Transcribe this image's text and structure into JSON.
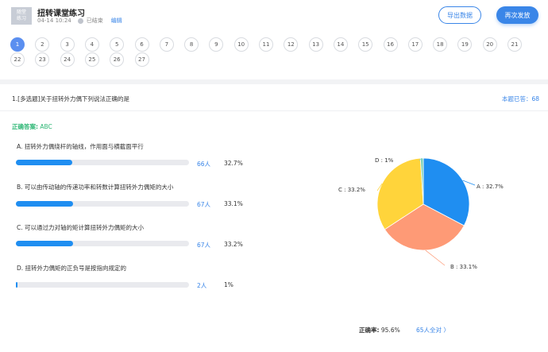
{
  "header": {
    "thumb_line1": "随堂",
    "thumb_line2": "练习",
    "title": "扭转课堂练习",
    "date": "04-14 10:24",
    "status": "已结束",
    "edit_label": "编辑",
    "export_label": "导出数据",
    "resend_label": "再次发放"
  },
  "question_numbers": [
    "1",
    "2",
    "3",
    "4",
    "5",
    "6",
    "7",
    "8",
    "9",
    "10",
    "11",
    "12",
    "13",
    "14",
    "15",
    "16",
    "17",
    "18",
    "19",
    "20",
    "21",
    "22",
    "23",
    "24",
    "25",
    "26",
    "27"
  ],
  "active_question": "1",
  "question": {
    "title": "1.[多选题]关于扭转外力偶下列说法正确的是",
    "answered_label": "本题已答：68",
    "correct_label": "正确答案:",
    "correct_value": "ABC"
  },
  "options": [
    {
      "text": "A. 扭转外力偶绕杆的轴线，作用面与横截面平行",
      "count": "66人",
      "percent": "32.7%",
      "ratio": 0.327
    },
    {
      "text": "B. 可以由传动轴的传递功率和转数计算扭转外力偶矩的大小",
      "count": "67人",
      "percent": "33.1%",
      "ratio": 0.331
    },
    {
      "text": "C. 可以通过力对轴的矩计算扭转外力偶矩的大小",
      "count": "67人",
      "percent": "33.2%",
      "ratio": 0.332
    },
    {
      "text": "D. 扭转外力偶矩的正负号是按指向规定的",
      "count": "2人",
      "percent": "1%",
      "ratio": 0.01
    }
  ],
  "chart_data": {
    "type": "pie",
    "slices": [
      {
        "label": "A : 32.7%",
        "value": 32.7,
        "color": "#1f8ef1"
      },
      {
        "label": "B : 33.1%",
        "value": 33.1,
        "color": "#fe9a76"
      },
      {
        "label": "C : 33.2%",
        "value": 33.2,
        "color": "#ffd43b"
      },
      {
        "label": "D : 1%",
        "value": 1.0,
        "color": "#7fd1b9"
      }
    ]
  },
  "footer": {
    "rate_label": "正确率:",
    "rate_value": "95.6%",
    "all_correct_link": "65人全对 〉"
  }
}
